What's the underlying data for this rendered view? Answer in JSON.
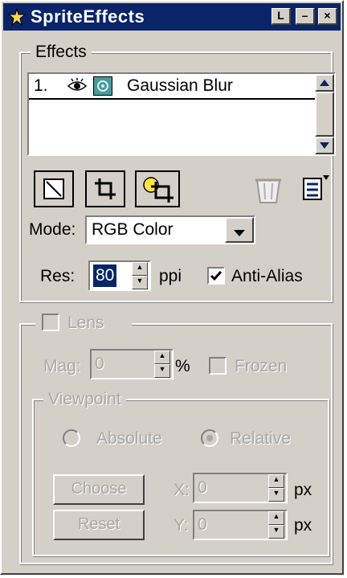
{
  "window": {
    "title": "SpriteEffects"
  },
  "titlebar_buttons": {
    "context": "L",
    "minimize": "–",
    "close": "×"
  },
  "effects": {
    "group_label": "Effects",
    "list": [
      {
        "index": "1.",
        "name": "Gaussian Blur",
        "visible": true
      }
    ],
    "mode_label": "Mode:",
    "mode_value": "RGB Color",
    "res_label": "Res:",
    "res_value": "80",
    "res_unit": "ppi",
    "anti_alias_label": "Anti-Alias",
    "anti_alias_checked": true
  },
  "lens": {
    "enabled_label": "Lens",
    "enabled": false,
    "mag_label": "Mag:",
    "mag_value": "0",
    "mag_unit": "%",
    "frozen_label": "Frozen",
    "frozen": false
  },
  "viewpoint": {
    "group_label": "Viewpoint",
    "absolute_label": "Absolute",
    "relative_label": "Relative",
    "selected": "relative",
    "choose_label": "Choose",
    "reset_label": "Reset",
    "x_label": "X:",
    "x_value": "0",
    "y_label": "Y:",
    "y_value": "0",
    "unit": "px"
  },
  "colors": {
    "titlebar": "#0a246a",
    "face": "#d4d0c8",
    "selection": "#0a246a"
  }
}
